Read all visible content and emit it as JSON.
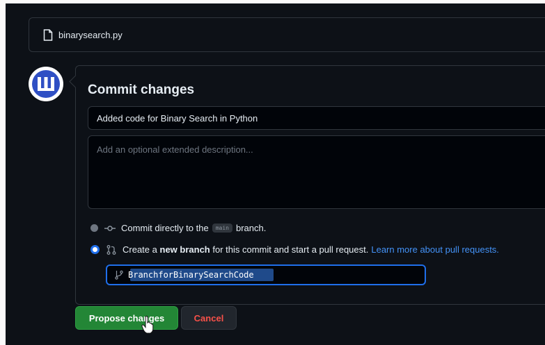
{
  "file": {
    "name": "binarysearch.py",
    "icon": "file-icon"
  },
  "avatar": {
    "icon": "avatar-logo-icon"
  },
  "commit": {
    "title": "Commit changes",
    "summary_value": "Added code for Binary Search in Python",
    "description_placeholder": "Add an optional extended description..."
  },
  "options": {
    "direct": {
      "prefix": "Commit directly to the",
      "branch_chip": "main",
      "suffix": "branch."
    },
    "new_branch": {
      "prefix": "Create a",
      "bold": "new branch",
      "suffix": "for this commit and start a pull request.",
      "link": "Learn more about pull requests."
    }
  },
  "branch_name": {
    "value": "BranchforBinarySearchCode"
  },
  "buttons": {
    "propose": "Propose changes",
    "cancel": "Cancel"
  },
  "colors": {
    "background": "#0d1117",
    "border": "#30363d",
    "accent_blue": "#1f6feb",
    "primary_green": "#238636",
    "danger_red": "#f85149",
    "link_blue": "#4493f8"
  }
}
